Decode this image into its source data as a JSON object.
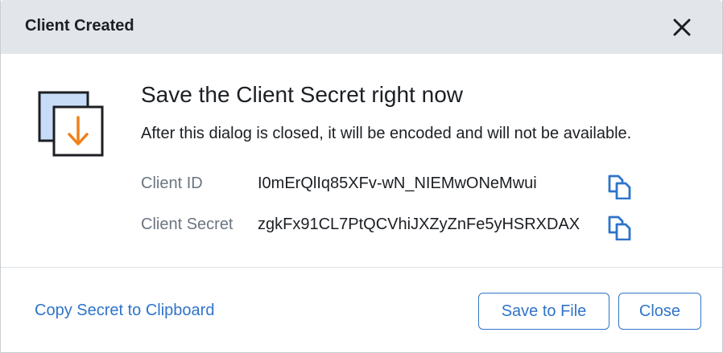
{
  "dialog": {
    "header_title": "Client Created",
    "close_icon": "close-icon",
    "title": "Save the Client Secret right now",
    "subtitle": "After this dialog is closed, it will be encoded and will not be available.",
    "fields": [
      {
        "label": "Client ID",
        "value": "I0mErQlIq85XFv-wN_NIEMwONeMwui"
      },
      {
        "label": "Client Secret",
        "value": "zgkFx91CL7PtQCVhiJXZyZnFe5yHSRXDAX"
      }
    ],
    "copy_icon": "copy-icon",
    "footer": {
      "copy_link": "Copy Secret to Clipboard",
      "save_button": "Save to File",
      "close_button": "Close"
    }
  },
  "colors": {
    "header_bg": "#e2e6ea",
    "accent": "#2f74c9",
    "arrow": "#f0811a",
    "label": "#6b7580"
  }
}
